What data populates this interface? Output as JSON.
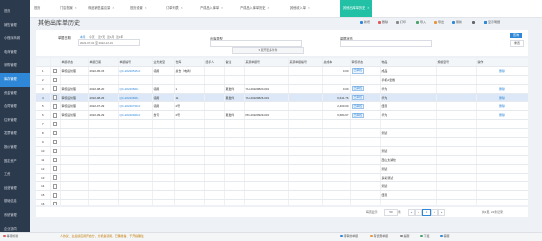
{
  "sidebar": {
    "items": [
      {
        "label": "首页",
        "active": false
      },
      {
        "label": "销售管理",
        "active": false
      },
      {
        "label": "小程序商城",
        "active": false
      },
      {
        "label": "电商管理",
        "active": false
      },
      {
        "label": "采购管理",
        "active": false
      },
      {
        "label": "库存管理",
        "active": true
      },
      {
        "label": "资金管理",
        "active": false
      },
      {
        "label": "合同管理",
        "active": false
      },
      {
        "label": "往来管理",
        "active": false
      },
      {
        "label": "发票管理",
        "active": false
      },
      {
        "label": "报价管理",
        "active": false
      },
      {
        "label": "固定资产",
        "active": false
      },
      {
        "label": "工资",
        "active": false
      },
      {
        "label": "经营管理",
        "active": false
      },
      {
        "label": "基础信息",
        "active": false
      },
      {
        "label": "系统管理",
        "active": false
      },
      {
        "label": "企业协同",
        "active": false
      }
    ]
  },
  "tabs": [
    {
      "label": "首页",
      "active": false
    },
    {
      "label": "门店档案",
      "active": false
    },
    {
      "label": "商品销售建议量",
      "active": false
    },
    {
      "label": "首页设置",
      "active": false
    },
    {
      "label": "订单列表",
      "active": false
    },
    {
      "label": "产成品入库单",
      "active": false
    },
    {
      "label": "产成品入库单历史",
      "active": false
    },
    {
      "label": "其他收入单",
      "active": false
    },
    {
      "label": "其他出库单历史",
      "active": true
    }
  ],
  "page_title": "其他出库单历史",
  "toolbar": {
    "new": "新增",
    "delete": "删除",
    "print": "打印",
    "import": "导入",
    "export": "导出",
    "refresh": "刷新",
    "show_detail": "显示明细"
  },
  "filter": {
    "date_label": "单据日期",
    "date_quick": [
      "本月",
      "今天",
      "近7天",
      "近1月",
      "近1年"
    ],
    "date_range": "2022-07-01 至 2022-12-31",
    "type_label": "出库类型",
    "status_label": "单据状态",
    "expand_label": "展开更多条件",
    "query_button": "查询",
    "reset_button": "重置"
  },
  "table": {
    "headers": [
      "",
      "",
      "单据状态",
      "单据日期",
      "单据编号",
      "业务类型",
      "仓库",
      "经手人",
      "备注",
      "来源单据号",
      "来源单据编号",
      "总成本",
      "审核状态",
      "物品",
      "规格型号",
      "操作"
    ],
    "rows": [
      {
        "no": "1",
        "status": "审核后处理",
        "date": "2022-05-15",
        "code": "QC-20220515-0",
        "biz": "领用",
        "wh": "总仓（电商）",
        "handler": "",
        "remark": "",
        "src": "",
        "src_code": "",
        "cost": "0.00",
        "audit": "已审核",
        "item": "成品",
        "spec": "",
        "sel": false
      },
      {
        "no": "2",
        "status": "",
        "date": "",
        "code": "",
        "biz": "",
        "wh": "",
        "handler": "",
        "remark": "",
        "src": "",
        "src_code": "",
        "cost": "",
        "audit": "",
        "item": "手机A套餐",
        "spec": "",
        "sel": false
      },
      {
        "no": "3",
        "status": "审核后处理",
        "date": "2022-08-20",
        "code": "QC-20220820-",
        "biz": "领用",
        "wh": "1",
        "handler": "",
        "remark": "夏发件",
        "src": "YH-20220820-001",
        "src_code": "",
        "cost": "0.00",
        "audit": "已审核",
        "item": "华为",
        "spec": "",
        "sel": false
      },
      {
        "no": "4",
        "status": "审核后处理",
        "date": "2022-08-26",
        "code": "QC-20220826-",
        "biz": "领用",
        "wh": "11",
        "handler": "",
        "remark": "夏发件",
        "src": "YH-20220826-001",
        "src_code": "",
        "cost": "6,641.76",
        "audit": "已审核",
        "item": "华为",
        "spec": "",
        "sel": true
      },
      {
        "no": "5",
        "status": "审核后处理",
        "date": "2022-07-29",
        "code": "QC-20220729-0",
        "biz": "领用",
        "wh": "2号",
        "handler": "",
        "remark": "",
        "src": "",
        "src_code": "",
        "cost": "2,400.00",
        "audit": "已审核",
        "item": "纽曼",
        "spec": "",
        "sel": false
      },
      {
        "no": "6",
        "status": "审核后处理",
        "date": "2022-09-29",
        "code": "QC-20220929-0",
        "biz": "盘亏",
        "wh": "2号",
        "handler": "",
        "remark": "夏发件",
        "src": "PD-20220929-001",
        "src_code": "",
        "cost": "6,684.67",
        "audit": "已审核",
        "item": "华为",
        "spec": "",
        "sel": false
      },
      {
        "no": "7",
        "status": "",
        "date": "",
        "code": "",
        "biz": "",
        "wh": "",
        "handler": "",
        "remark": "",
        "src": "",
        "src_code": "",
        "cost": "",
        "audit": "",
        "item": "",
        "spec": "",
        "sel": false
      },
      {
        "no": "8",
        "status": "",
        "date": "",
        "code": "",
        "biz": "",
        "wh": "",
        "handler": "",
        "remark": "",
        "src": "",
        "src_code": "",
        "cost": "",
        "audit": "",
        "item": "测试",
        "spec": "",
        "sel": false
      },
      {
        "no": "9",
        "status": "",
        "date": "",
        "code": "",
        "biz": "",
        "wh": "",
        "handler": "",
        "remark": "",
        "src": "",
        "src_code": "",
        "cost": "",
        "audit": "",
        "item": "",
        "spec": "",
        "sel": false
      },
      {
        "no": "10",
        "status": "",
        "date": "",
        "code": "",
        "biz": "",
        "wh": "",
        "handler": "",
        "remark": "",
        "src": "",
        "src_code": "",
        "cost": "",
        "audit": "",
        "item": "测试",
        "spec": "",
        "sel": false
      },
      {
        "no": "11",
        "status": "",
        "date": "",
        "code": "",
        "biz": "",
        "wh": "",
        "handler": "",
        "remark": "",
        "src": "",
        "src_code": "",
        "cost": "",
        "audit": "",
        "item": "西山太湖炫",
        "spec": "",
        "sel": false
      },
      {
        "no": "12",
        "status": "",
        "date": "",
        "code": "",
        "biz": "",
        "wh": "",
        "handler": "",
        "remark": "",
        "src": "",
        "src_code": "",
        "cost": "",
        "audit": "",
        "item": "测试",
        "spec": "",
        "sel": false
      },
      {
        "no": "13",
        "status": "",
        "date": "",
        "code": "",
        "biz": "",
        "wh": "",
        "handler": "",
        "remark": "",
        "src": "",
        "src_code": "",
        "cost": "",
        "audit": "",
        "item": "多彩测试",
        "spec": "",
        "sel": false
      },
      {
        "no": "14",
        "status": "",
        "date": "",
        "code": "",
        "biz": "",
        "wh": "",
        "handler": "",
        "remark": "",
        "src": "",
        "src_code": "",
        "cost": "",
        "audit": "",
        "item": "测试",
        "spec": "",
        "sel": false
      },
      {
        "no": "15",
        "status": "",
        "date": "",
        "code": "",
        "biz": "",
        "wh": "",
        "handler": "",
        "remark": "",
        "src": "",
        "src_code": "",
        "cost": "",
        "audit": "",
        "item": "纽曼",
        "spec": "",
        "sel": false
      },
      {
        "no": "16",
        "status": "",
        "date": "",
        "code": "",
        "biz": "",
        "wh": "",
        "handler": "",
        "remark": "",
        "src": "",
        "src_code": "",
        "cost": "",
        "audit": "",
        "item": "",
        "spec": "",
        "sel": false
      }
    ],
    "sum_label": "合计",
    "action": "删除"
  },
  "pager": {
    "page_size_label": "每页显示",
    "page_size": "50",
    "unit": "条",
    "current": "1",
    "total_label": "共1页, 21条记录"
  },
  "status": {
    "left": "等待检验",
    "notice": "人协议、主后续应用开启分，分机备就用、已确准备、于开指确注",
    "right1": "待审的单据",
    "right2": "有优惠单据",
    "right3": "提醒",
    "right4": "下载",
    "right5": "客服"
  },
  "colors": {
    "sidebar_bg": "#2c3a4e",
    "accent": "#2f87d8",
    "active_tab": "#22c1a5"
  }
}
